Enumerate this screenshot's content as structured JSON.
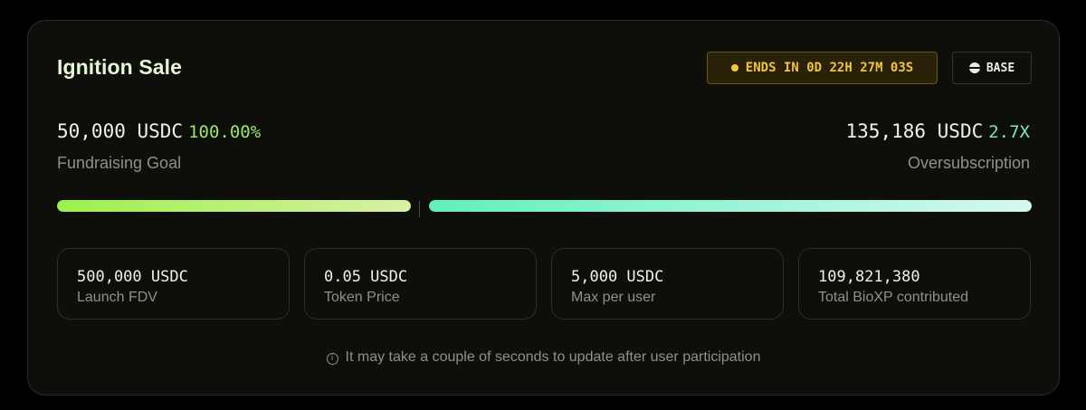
{
  "sale": {
    "title": "Ignition Sale",
    "timer": "ENDS IN 0D 22H 27M 03S",
    "chain": "BASE"
  },
  "fundraising": {
    "amount": "50,000 USDC",
    "percent": "100.00%",
    "label": "Fundraising Goal",
    "progress": 1.0
  },
  "oversubscription": {
    "amount": "135,186 USDC",
    "multiplier": "2.7X",
    "label": "Oversubscription",
    "progress": 1.0
  },
  "stats": [
    {
      "value": "500,000 USDC",
      "label": "Launch FDV"
    },
    {
      "value": "0.05 USDC",
      "label": "Token Price"
    },
    {
      "value": "5,000 USDC",
      "label": "Max per user"
    },
    {
      "value": "109,821,380",
      "label": "Total BioXP contributed"
    }
  ],
  "note": "It may take a couple of seconds to update after user participation",
  "colors": {
    "goal_accent": "#9be86a",
    "over_accent": "#76e8c4",
    "timer_accent": "#f0c43c"
  },
  "icons": {
    "timer": "dot-icon",
    "chain": "base-logo-icon",
    "note": "info-icon"
  }
}
